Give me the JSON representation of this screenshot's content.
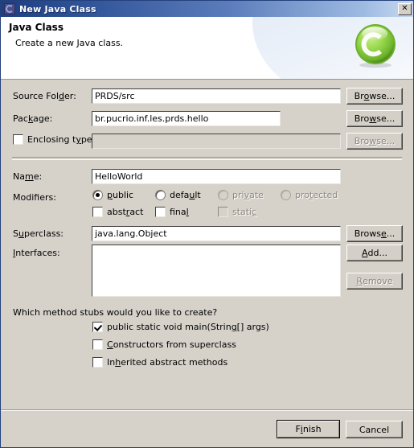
{
  "window": {
    "title": "New Java Class",
    "icon": "eclipse-icon",
    "close_label": "✕"
  },
  "header": {
    "title": "Java Class",
    "description": "Create a new Java class.",
    "icon": "java-class-green-c-icon",
    "accent_color": "#7dc23a"
  },
  "form": {
    "source_folder": {
      "label_pre": "Source Fol",
      "label_mnemonic": "d",
      "label_post": "er:",
      "value": "PRDS/src",
      "browse": {
        "pre": "Br",
        "mn": "o",
        "post": "wse..."
      }
    },
    "package": {
      "label_pre": "Pac",
      "label_mnemonic": "k",
      "label_post": "age:",
      "value": "br.pucrio.inf.les.prds.hello",
      "browse": {
        "pre": "Bro",
        "mn": "w",
        "post": "se..."
      }
    },
    "enclosing_type": {
      "label_pre": "Enclosing t",
      "label_mnemonic": "y",
      "label_post": "pe:",
      "checked": false,
      "value": "",
      "enabled": false,
      "browse": {
        "pre": "Bro",
        "mn": "w",
        "post": "se..."
      }
    },
    "name": {
      "label_pre": "Na",
      "label_mnemonic": "m",
      "label_post": "e:",
      "value": "HelloWorld"
    },
    "modifiers": {
      "label": "Modifiers:",
      "radios": [
        {
          "pre": "",
          "mn": "p",
          "post": "ublic",
          "checked": true,
          "enabled": true
        },
        {
          "pre": "defa",
          "mn": "u",
          "post": "lt",
          "checked": false,
          "enabled": true
        },
        {
          "pre": "pri",
          "mn": "v",
          "post": "ate",
          "checked": false,
          "enabled": false
        },
        {
          "pre": "pro",
          "mn": "t",
          "post": "ected",
          "checked": false,
          "enabled": false
        }
      ],
      "checkboxes": [
        {
          "pre": "abst",
          "mn": "r",
          "post": "act",
          "checked": false,
          "enabled": true
        },
        {
          "pre": "fina",
          "mn": "l",
          "post": "",
          "checked": false,
          "enabled": true
        },
        {
          "pre": "stati",
          "mn": "c",
          "post": "",
          "checked": false,
          "enabled": false
        }
      ]
    },
    "superclass": {
      "label_pre": "S",
      "label_mnemonic": "u",
      "label_post": "perclass:",
      "value": "java.lang.Object",
      "browse": {
        "pre": "Brows",
        "mn": "e",
        "post": "..."
      }
    },
    "interfaces": {
      "label_pre": "",
      "label_mnemonic": "I",
      "label_post": "nterfaces:",
      "items": [],
      "add": {
        "pre": "",
        "mn": "A",
        "post": "dd..."
      },
      "remove": {
        "pre": "",
        "mn": "R",
        "post": "emove",
        "enabled": false
      }
    },
    "method_stubs": {
      "question": "Which method stubs would you like to create?",
      "options": [
        {
          "pre": "public static void main(Strin",
          "mn": "g",
          "post": "[] args)",
          "checked": true
        },
        {
          "pre": "",
          "mn": "C",
          "post": "onstructors from superclass",
          "checked": false
        },
        {
          "pre": "In",
          "mn": "h",
          "post": "erited abstract methods",
          "checked": false
        }
      ]
    }
  },
  "footer": {
    "finish": {
      "pre": "F",
      "mn": "i",
      "post": "nish"
    },
    "cancel": {
      "pre": "Cancel",
      "mn": "",
      "post": ""
    }
  }
}
